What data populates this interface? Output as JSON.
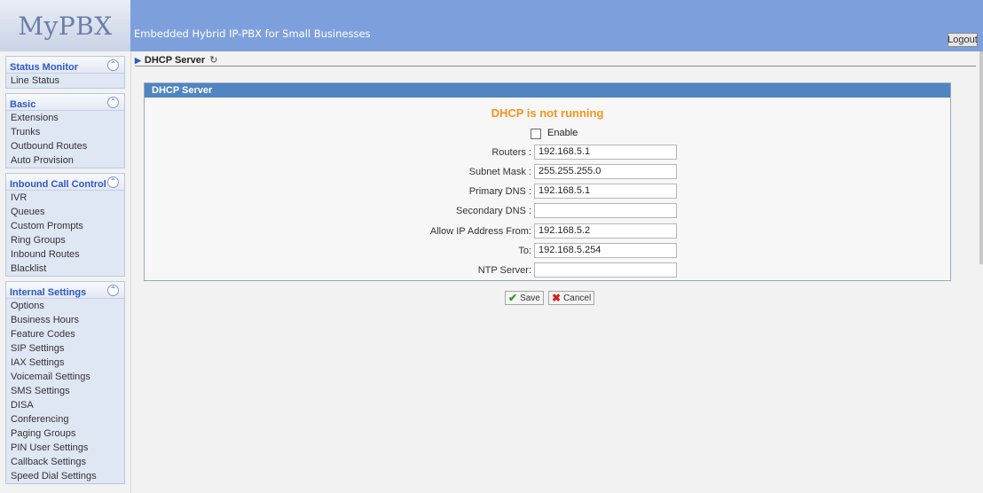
{
  "header": {
    "logo": "MyPBX",
    "tagline": "Embedded Hybrid IP-PBX for Small Businesses",
    "logout_label": "Logout"
  },
  "sidebar": {
    "sections": [
      {
        "title": "Status Monitor",
        "items": [
          "Line Status"
        ]
      },
      {
        "title": "Basic",
        "items": [
          "Extensions",
          "Trunks",
          "Outbound Routes",
          "Auto Provision"
        ]
      },
      {
        "title": "Inbound Call Control",
        "items": [
          "IVR",
          "Queues",
          "Custom Prompts",
          "Ring Groups",
          "Inbound Routes",
          "Blacklist"
        ]
      },
      {
        "title": "Internal Settings",
        "items": [
          "Options",
          "Business Hours",
          "Feature Codes",
          "SIP Settings",
          "IAX Settings",
          "Voicemail Settings",
          "SMS Settings",
          "DISA",
          "Conferencing",
          "Paging Groups",
          "PIN User Settings",
          "Callback Settings",
          "Speed Dial Settings"
        ]
      }
    ]
  },
  "breadcrumb": {
    "label": "DHCP Server"
  },
  "panel": {
    "title": "DHCP Server",
    "status": "DHCP is not running",
    "enable_label": "Enable",
    "fields": [
      {
        "label": "Routers :",
        "value": "192.168.5.1"
      },
      {
        "label": "Subnet Mask :",
        "value": "255.255.255.0"
      },
      {
        "label": "Primary DNS :",
        "value": "192.168.5.1"
      },
      {
        "label": "Secondary DNS :",
        "value": ""
      },
      {
        "label": "Allow IP Address From:",
        "value": "192.168.5.2"
      },
      {
        "label": "To:",
        "value": "192.168.5.254"
      },
      {
        "label": "NTP Server:",
        "value": ""
      }
    ]
  },
  "actions": {
    "save_label": "Save",
    "cancel_label": "Cancel"
  },
  "colors": {
    "header": "#7da0dd",
    "panel_header": "#4f85c0",
    "status": "#f7941d",
    "nav_title": "#2c58c8"
  }
}
